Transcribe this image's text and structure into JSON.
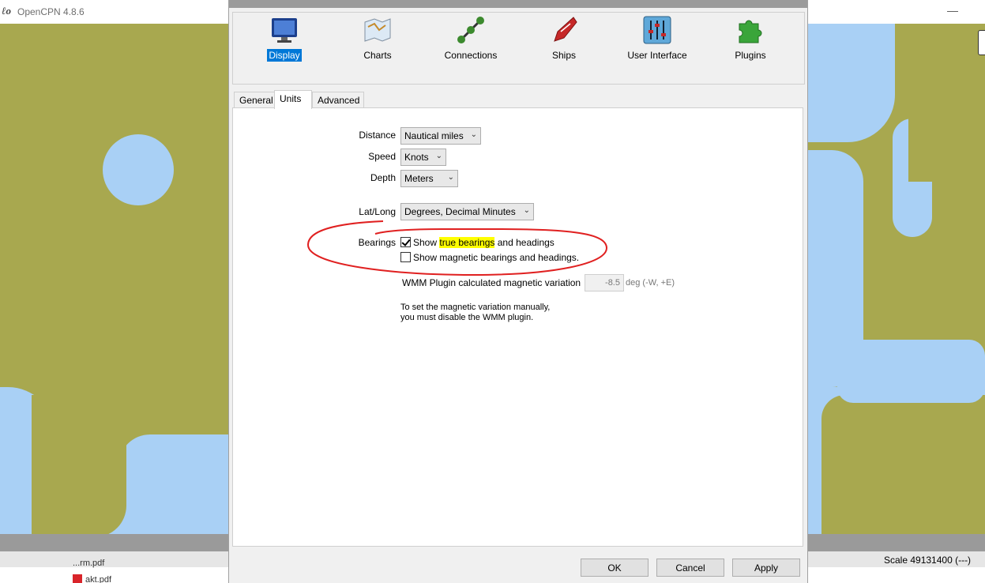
{
  "app": {
    "title": "OpenCPN 4.8.6",
    "icon": "opencpn-logo-icon",
    "minimize": "—"
  },
  "status": {
    "scale": "Scale 49131400 (---)"
  },
  "files": [
    {
      "name": "...rm.pdf"
    },
    {
      "name": "akt.pdf"
    }
  ],
  "toolbar": {
    "items": [
      {
        "label": "Display",
        "icon": "monitor-icon"
      },
      {
        "label": "Charts",
        "icon": "charts-icon"
      },
      {
        "label": "Connections",
        "icon": "connections-icon"
      },
      {
        "label": "Ships",
        "icon": "ship-icon"
      },
      {
        "label": "User Interface",
        "icon": "sliders-icon"
      },
      {
        "label": "Plugins",
        "icon": "puzzle-icon"
      }
    ],
    "active": "Display"
  },
  "tabs": [
    {
      "label": "General"
    },
    {
      "label": "Units"
    },
    {
      "label": "Advanced"
    }
  ],
  "units": {
    "distance": {
      "label": "Distance",
      "value": "Nautical miles"
    },
    "speed": {
      "label": "Speed",
      "value": "Knots"
    },
    "depth": {
      "label": "Depth",
      "value": "Meters"
    },
    "latlong": {
      "label": "Lat/Long",
      "value": "Degrees, Decimal Minutes"
    },
    "bearings": {
      "label": "Bearings",
      "true": {
        "pre": "Show ",
        "highlight": "true bearings",
        "post": " and headings",
        "checked": true
      },
      "magnetic": {
        "label": "Show magnetic bearings and headings.",
        "checked": false
      }
    },
    "magvar": {
      "label": "WMM Plugin calculated magnetic variation",
      "value": "-8.5",
      "unit": "deg (-W, +E)"
    },
    "note": {
      "line1": "To set the magnetic variation manually,",
      "line2": "you must disable the WMM plugin."
    }
  },
  "buttons": {
    "ok": "OK",
    "cancel": "Cancel",
    "apply": "Apply"
  },
  "colors": {
    "land": "#a8a84f",
    "water": "#a9d0f5",
    "accent": "#0078d7",
    "annotation": "#e02020"
  }
}
